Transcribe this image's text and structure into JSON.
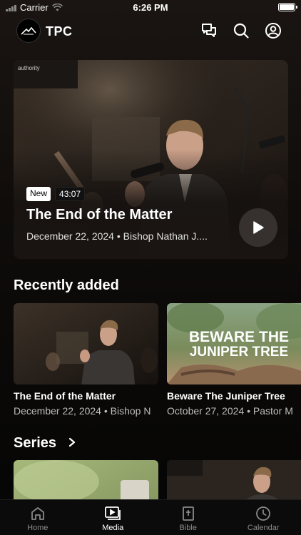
{
  "status_bar": {
    "carrier": "Carrier",
    "time": "6:26 PM"
  },
  "header": {
    "brand": "TPC",
    "icons": [
      "chat-icon",
      "search-icon",
      "profile-icon"
    ]
  },
  "hero": {
    "badge_new": "New",
    "duration": "43:07",
    "title": "The End of the Matter",
    "meta": "December 22, 2024 • Bishop Nathan J....",
    "image_caption": "authority"
  },
  "recently_added": {
    "title": "Recently added",
    "items": [
      {
        "title": "The End of the Matter",
        "meta": "December 22, 2024 • Bishop N"
      },
      {
        "title": "Beware The Juniper Tree",
        "meta": "October 27, 2024 • Pastor M",
        "thumb_text_1": "BEWARE THE",
        "thumb_text_2": "JUNIPER TREE"
      }
    ]
  },
  "series": {
    "title": "Series"
  },
  "tabbar": {
    "tabs": [
      {
        "label": "Home",
        "icon": "home-icon"
      },
      {
        "label": "Media",
        "icon": "media-icon",
        "active": true
      },
      {
        "label": "Bible",
        "icon": "bible-icon"
      },
      {
        "label": "Calendar",
        "icon": "calendar-icon"
      }
    ]
  }
}
